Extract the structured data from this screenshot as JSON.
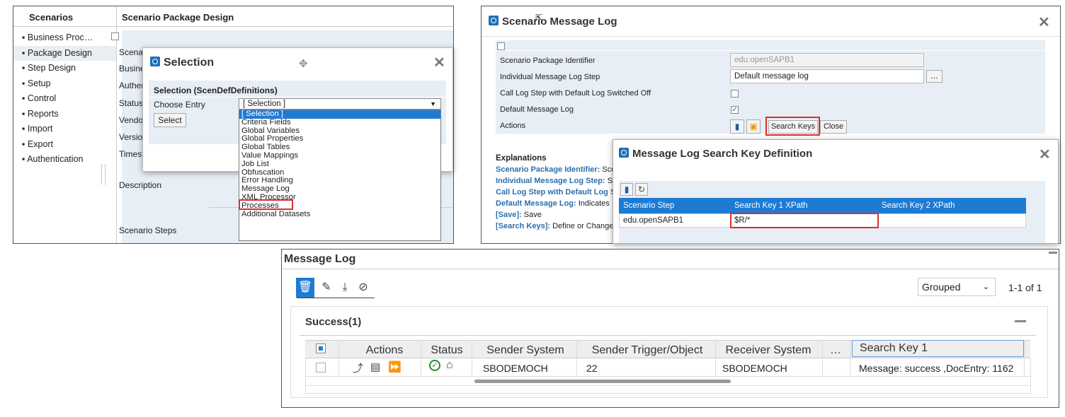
{
  "panel1": {
    "sidebar": {
      "header": "Scenarios",
      "items": [
        {
          "label": "Business Proc…"
        },
        {
          "label": "Package Design"
        },
        {
          "label": "Step Design"
        },
        {
          "label": "Setup"
        },
        {
          "label": "Control"
        },
        {
          "label": "Reports"
        },
        {
          "label": "Import"
        },
        {
          "label": "Export"
        },
        {
          "label": "Authentication"
        }
      ]
    },
    "title": "Scenario Package Design",
    "partial_labels": [
      "Scenar",
      "Busines",
      "Authen",
      "Status",
      "Vendor",
      "Version",
      "Timesta"
    ],
    "description_label": "Description",
    "steps_label": "Scenario Steps",
    "dialog": {
      "title": "Selection",
      "subheader": "Selection (ScenDefDefinitions)",
      "choose_label": "Choose Entry",
      "select_value": "[ Selection ]",
      "select_button": "Select",
      "options": [
        "[ Selection ]",
        "Criteria Fields",
        "Global Variables",
        "Global Properties",
        "Global Tables",
        "Value Mappings",
        "Job List",
        "Obfuscation",
        "Error Handling",
        "Message Log",
        "XML Processor",
        "Processes",
        "Additional Datasets"
      ],
      "selected_option": "[ Selection ]",
      "highlighted_option": "Message Log"
    }
  },
  "panel2": {
    "title": "Scenario Message Log",
    "rows": [
      {
        "label": "Scenario Package Identifier",
        "value": "edu.openSAPB1"
      },
      {
        "label": "Individual Message Log Step",
        "value": "Default message log",
        "ellipsis": "..."
      },
      {
        "label": "Call Log Step with Default Log Switched Off",
        "checked": false
      },
      {
        "label": "Default Message Log",
        "checked": true
      },
      {
        "label": "Actions",
        "search_keys": "Search Keys",
        "close": "Close"
      }
    ],
    "explanations": {
      "header": "Explanations",
      "lines": [
        {
          "key": "Scenario Package Identifier:",
          "text": " Sce"
        },
        {
          "key": "Individual Message Log Step:",
          "text": " S"
        },
        {
          "key": "Call Log Step with Default Log S",
          "text": ""
        },
        {
          "key": "Default Message Log:",
          "text": " Indicates"
        },
        {
          "key": "[Save]:",
          "text": " Save"
        },
        {
          "key": "[Search Keys]:",
          "text": " Define or Change"
        }
      ]
    },
    "dialog": {
      "title": "Message Log Search Key Definition",
      "columns": [
        "Scenario Step",
        "Search Key 1 XPath",
        "Search Key 2 XPath"
      ],
      "row": [
        "edu.openSAPB1",
        "$R/*",
        ""
      ]
    }
  },
  "panel3": {
    "title": "Message Log",
    "group_select": "Grouped",
    "pagination": "1-1 of 1",
    "group_title": "Success(1)",
    "columns": [
      "Actions",
      "Status",
      "Sender System",
      "Sender Trigger/Object",
      "Receiver System",
      "…",
      "Search Key 1"
    ],
    "row": {
      "sender_system": "SBODEMOCH",
      "trigger": "22",
      "receiver_system": "SBODEMOCH",
      "search_key": "Message: success ,DocEntry: 1162"
    }
  },
  "colors": {
    "accent": "#1e7bd3",
    "highlight_border": "#d9302e",
    "row_bg": "#e7eef5"
  }
}
